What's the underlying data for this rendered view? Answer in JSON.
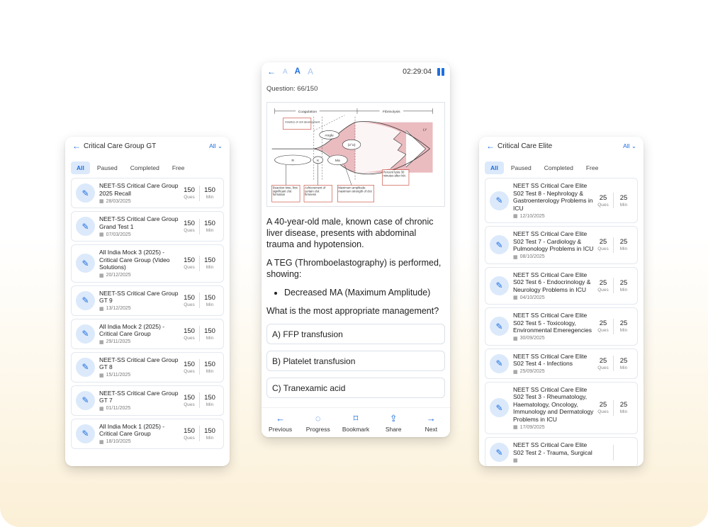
{
  "left_panel": {
    "title": "Critical Care Group GT",
    "filter": "All ⌄",
    "tabs": [
      "All",
      "Paused",
      "Completed",
      "Free"
    ],
    "items": [
      {
        "title": "NEET-SS Critical Care Group 2025 Recall",
        "date": "28/03/2025",
        "ques": "150",
        "ques_label": "Ques",
        "min": "150",
        "min_label": "Min"
      },
      {
        "title": "NEET-SS Critical Care Group Grand Test 1",
        "date": "07/03/2025",
        "ques": "150",
        "ques_label": "Ques",
        "min": "150",
        "min_label": "Min"
      },
      {
        "title": "All India Mock 3 (2025) - Critical Care Group (Video Solutions)",
        "date": "20/12/2025",
        "ques": "150",
        "ques_label": "Ques",
        "min": "150",
        "min_label": "Min"
      },
      {
        "title": "NEET-SS Critical Care Group GT 9",
        "date": "13/12/2025",
        "ques": "150",
        "ques_label": "Ques",
        "min": "150",
        "min_label": "Min"
      },
      {
        "title": "All India Mock 2 (2025) - Critical Care Group",
        "date": "29/11/2025",
        "ques": "150",
        "ques_label": "Ques",
        "min": "150",
        "min_label": "Min"
      },
      {
        "title": "NEET-SS Critical Care Group GT 8",
        "date": "15/11/2025",
        "ques": "150",
        "ques_label": "Ques",
        "min": "150",
        "min_label": "Min"
      },
      {
        "title": "NEET-SS Critical Care Group GT 7",
        "date": "01/11/2025",
        "ques": "150",
        "ques_label": "Ques",
        "min": "150",
        "min_label": "Min"
      },
      {
        "title": "All India Mock 1 (2025) - Critical Care Group",
        "date": "18/10/2025",
        "ques": "150",
        "ques_label": "Ques",
        "min": "150",
        "min_label": "Min"
      }
    ]
  },
  "center_panel": {
    "font_sizes": [
      "A",
      "A",
      "A"
    ],
    "timer": "02:29:04",
    "question_number": "Question: 66/150",
    "figure": {
      "coagulation": "Coagulation",
      "fibrinolysis": "Fibrinolysis",
      "kinetics": "Kinetics of clot development",
      "angle": "Angle",
      "alpha": "(2°α)",
      "ma": "Ma",
      "r": "R",
      "k": "K",
      "ly": "LY",
      "percent_lysis": "Percent lysis 30 minutes after MA",
      "reaction_time": "Reaction time, first significant clot formation",
      "achievement": "Achievement of certain clot firmness",
      "max_amp": "Maximum amplitude: maximum strength of clot"
    },
    "question_paragraphs": [
      "A 40-year-old male, known case of chronic liver disease, presents with abdominal trauma and hypotension.",
      "A TEG (Thromboelastography) is performed, showing:"
    ],
    "bullet": "Decreased MA (Maximum Amplitude)",
    "ask": "What is the most appropriate management?",
    "options": [
      "A) FFP transfusion",
      "B) Platelet transfusion",
      "C) Tranexamic acid"
    ],
    "nav": [
      {
        "icon": "arrow-left-icon",
        "label": "Previous"
      },
      {
        "icon": "progress-icon",
        "label": "Progress"
      },
      {
        "icon": "bookmark-icon",
        "label": "Bookmark"
      },
      {
        "icon": "share-icon",
        "label": "Share"
      },
      {
        "icon": "arrow-right-icon",
        "label": "Next"
      }
    ]
  },
  "right_panel": {
    "title": "Critical Care Elite",
    "filter": "All ⌄",
    "tabs": [
      "All",
      "Paused",
      "Completed",
      "Free"
    ],
    "items": [
      {
        "title": "NEET SS Critical Care Elite S02 Test 8 - Nephrology & Gastroenterology Problems in ICU",
        "date": "12/10/2025",
        "ques": "25",
        "ques_label": "Ques",
        "min": "25",
        "min_label": "Min"
      },
      {
        "title": "NEET SS Critical Care Elite S02 Test 7 - Cardiology & Pulmonology Problems in ICU",
        "date": "08/10/2025",
        "ques": "25",
        "ques_label": "Ques",
        "min": "25",
        "min_label": "Min"
      },
      {
        "title": "NEET SS Critical Care Elite S02 Test 6 - Endocrinology & Neurology Problems in ICU",
        "date": "04/10/2025",
        "ques": "25",
        "ques_label": "Ques",
        "min": "25",
        "min_label": "Min"
      },
      {
        "title": "NEET SS Critical Care Elite S02 Test 5 - Toxicology, Environmental Emeregencies",
        "date": "30/09/2025",
        "ques": "25",
        "ques_label": "Ques",
        "min": "25",
        "min_label": "Min"
      },
      {
        "title": "NEET SS Critical Care Elite S02 Test 4 - Infections",
        "date": "25/09/2025",
        "ques": "25",
        "ques_label": "Ques",
        "min": "25",
        "min_label": "Min"
      },
      {
        "title": "NEET SS Critical Care Elite S02 Test 3 - Rheumatology, Haematology, Oncology, Immunology and Dermatology Problems in ICU",
        "date": "17/09/2025",
        "ques": "25",
        "ques_label": "Ques",
        "min": "25",
        "min_label": "Min"
      },
      {
        "title": "NEET SS Critical Care Elite S02 Test 2 - Trauma, Surgical",
        "date": "",
        "ques": "",
        "ques_label": "",
        "min": "",
        "min_label": ""
      }
    ]
  }
}
